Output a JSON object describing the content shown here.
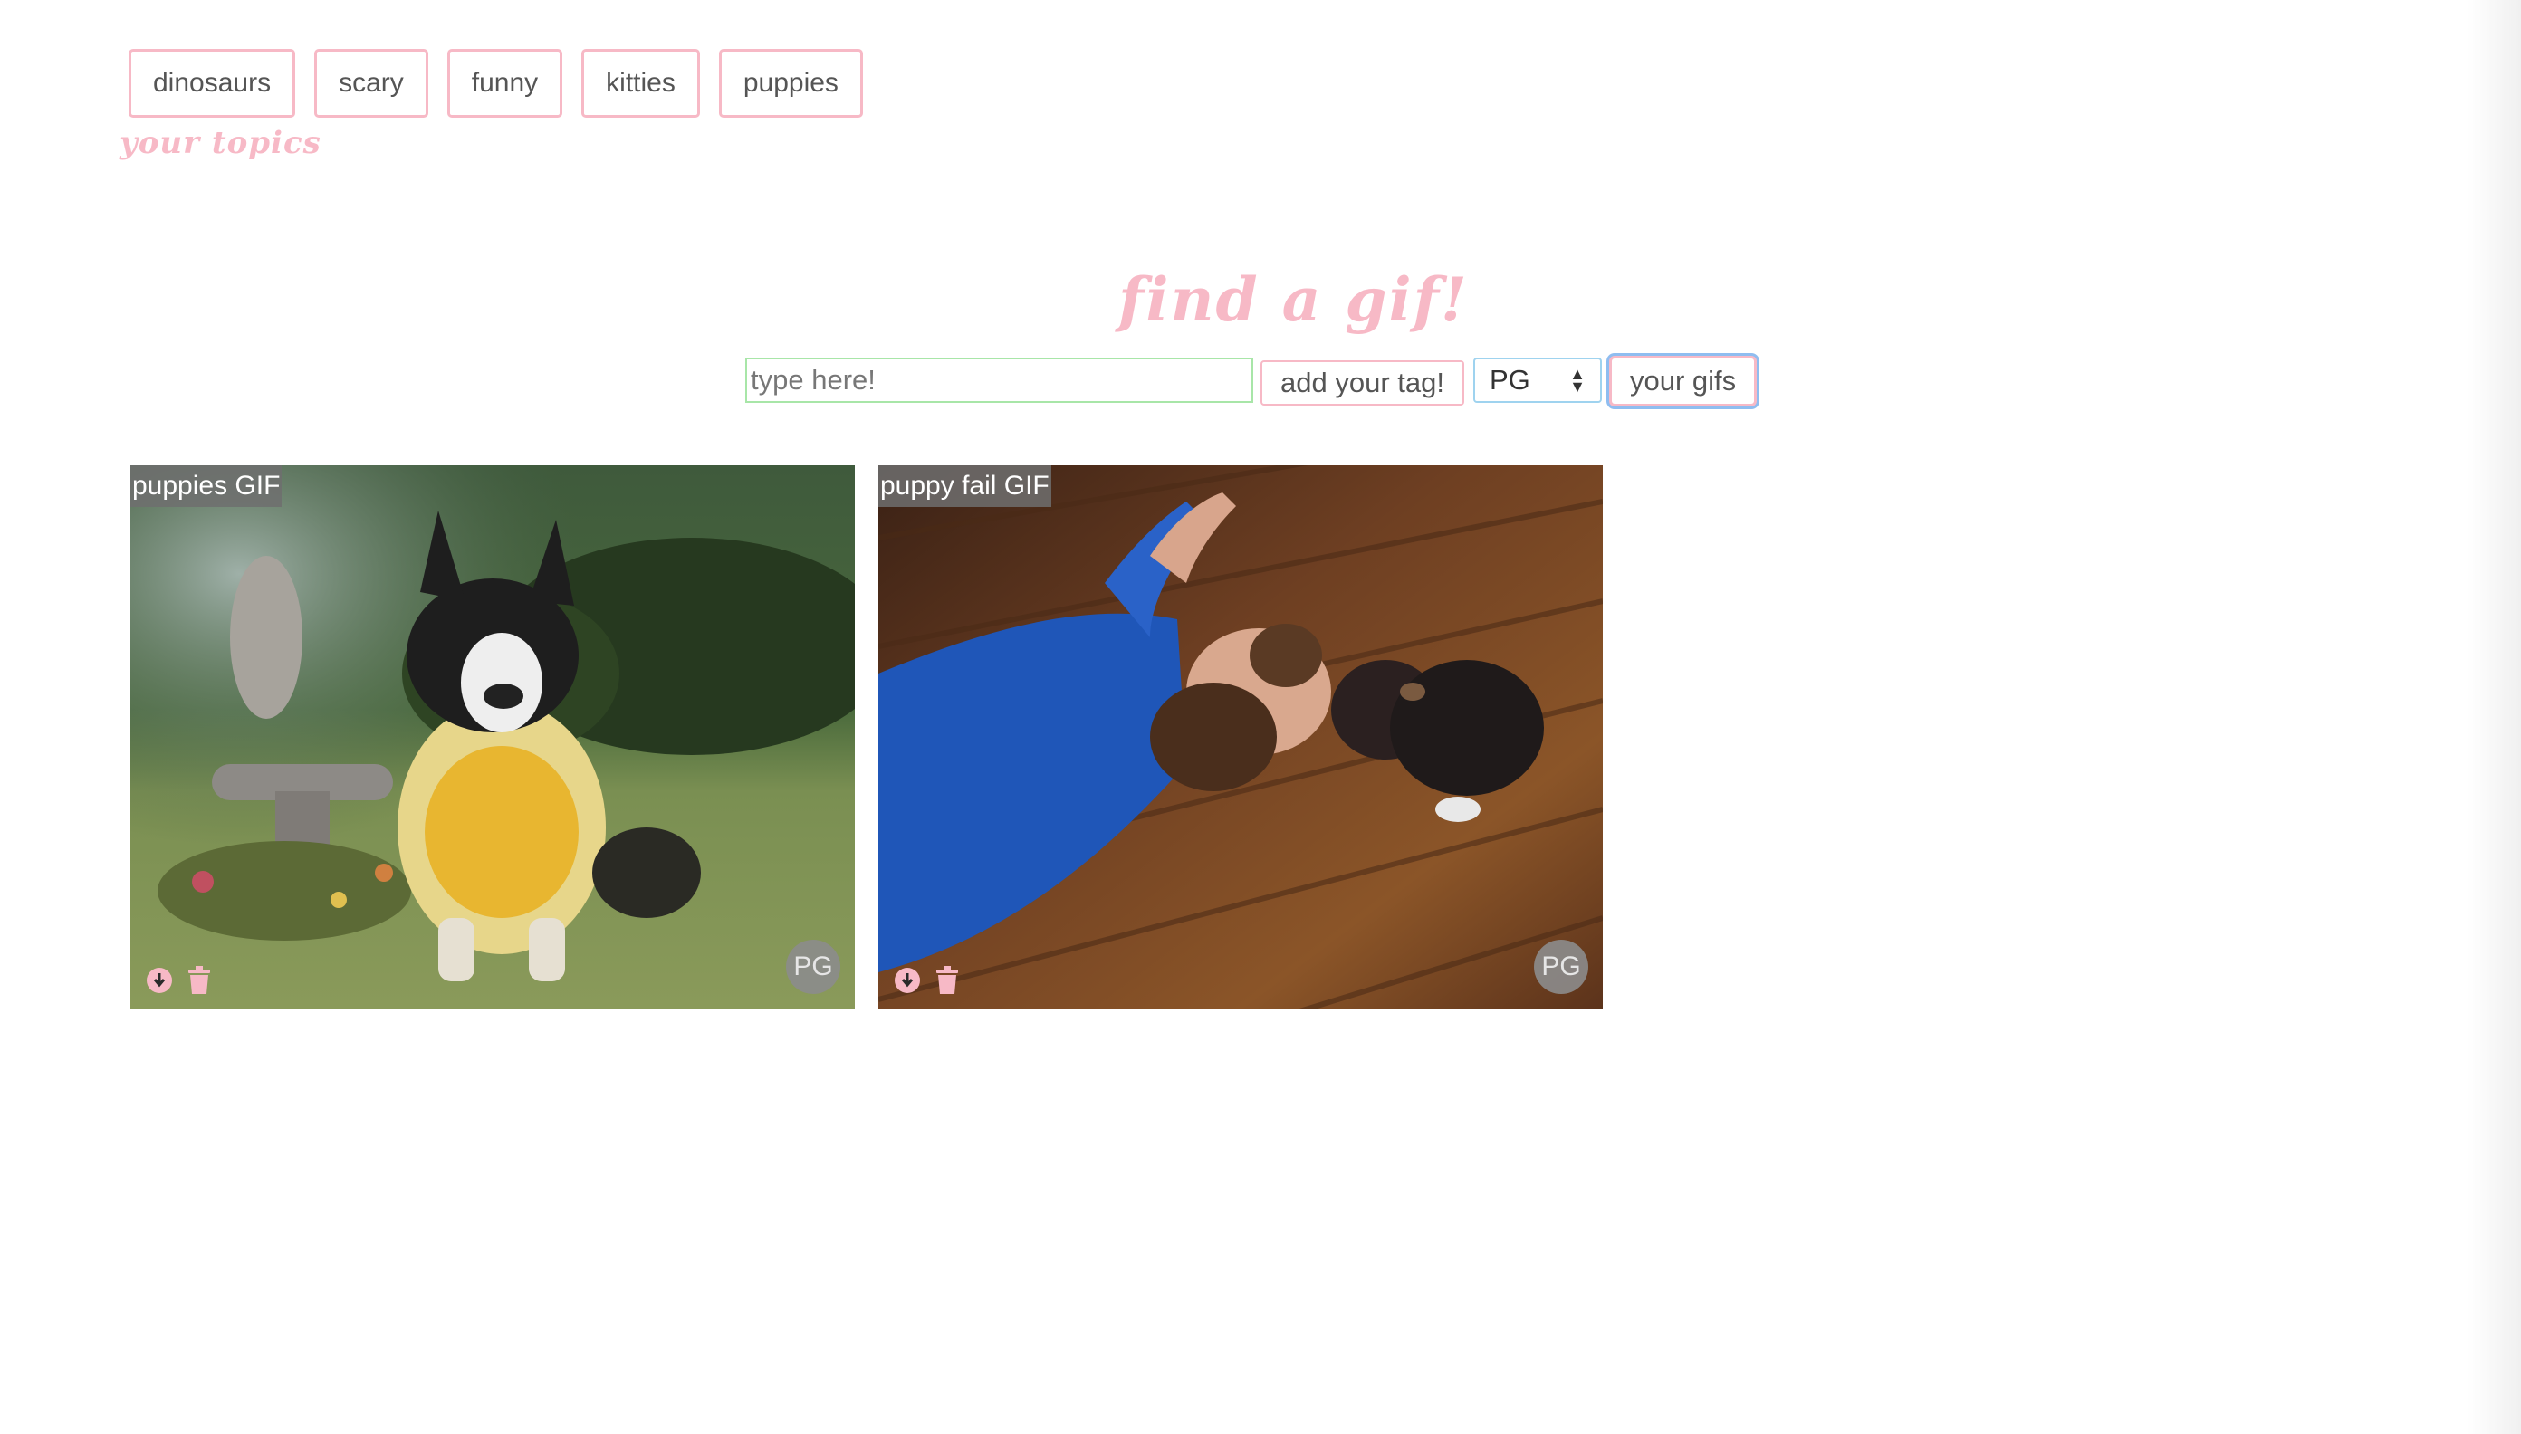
{
  "topics": {
    "label": "your topics",
    "items": [
      {
        "label": "dinosaurs"
      },
      {
        "label": "scary"
      },
      {
        "label": "funny"
      },
      {
        "label": "kitties"
      },
      {
        "label": "puppies"
      }
    ]
  },
  "search": {
    "title": "find a gif!",
    "input_value": "",
    "input_placeholder": "type here!",
    "add_tag_label": "add your tag!",
    "rating_selected": "PG",
    "your_gifs_label": "your gifs"
  },
  "gifs": [
    {
      "title": "puppies GIF",
      "rating": "PG",
      "download_icon": "download-circle-icon",
      "delete_icon": "trash-icon"
    },
    {
      "title": "puppy fail GIF",
      "rating": "PG",
      "download_icon": "download-circle-icon",
      "delete_icon": "trash-icon"
    }
  ],
  "colors": {
    "accent_pink": "#f7b9c6",
    "input_border_green": "#a8e6a8",
    "focus_ring_blue": "#8fbdf0"
  }
}
